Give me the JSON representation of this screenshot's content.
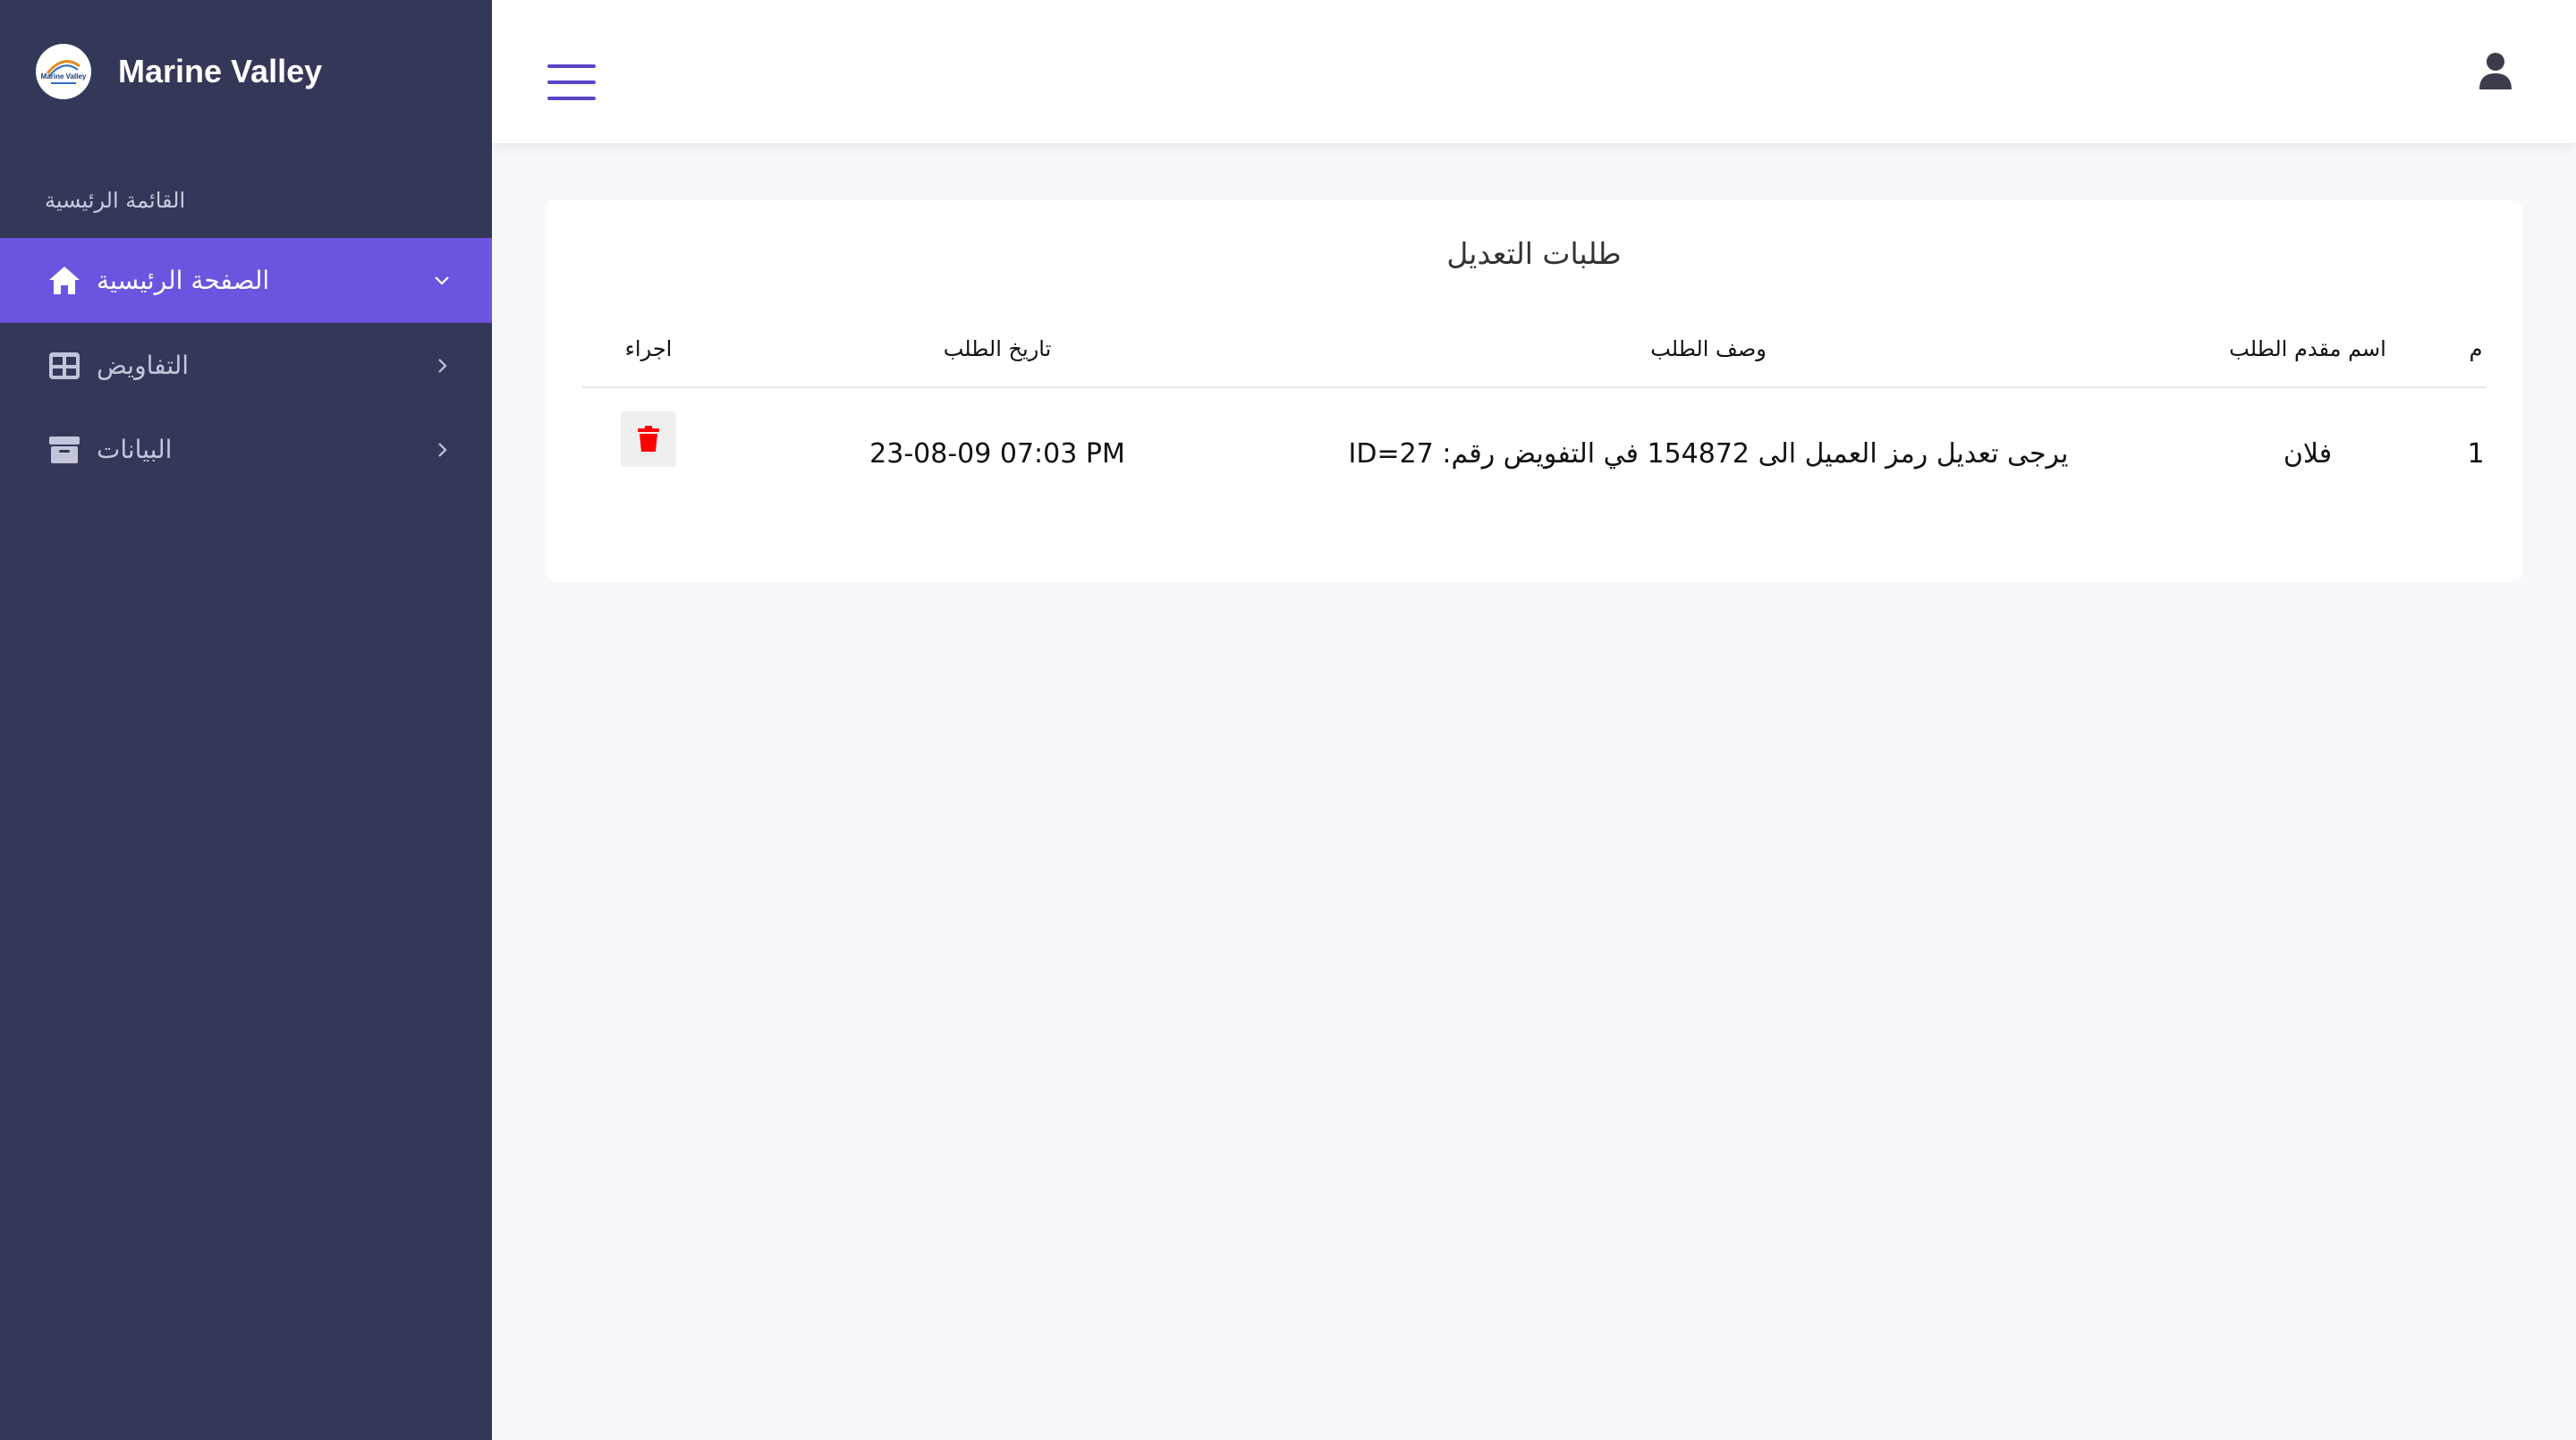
{
  "brand": {
    "name": "Marine Valley",
    "logo_text": "Marine Valley"
  },
  "sidebar": {
    "section_label": "القائمة الرئيسية",
    "items": [
      {
        "label": "الصفحة الرئيسية",
        "icon": "home-icon",
        "active": true,
        "chevron": "chevron-down-icon"
      },
      {
        "label": "التفاويض",
        "icon": "table-icon",
        "active": false,
        "chevron": "chevron-right-icon"
      },
      {
        "label": "البيانات",
        "icon": "archive-icon",
        "active": false,
        "chevron": "chevron-right-icon"
      }
    ]
  },
  "header": {
    "menu_icon": "hamburger-icon",
    "user_icon": "user-icon"
  },
  "card": {
    "title": "طلبات التعديل",
    "columns": [
      "م",
      "اسم مقدم الطلب",
      "وصف الطلب",
      "تاريخ الطلب",
      "اجراء"
    ],
    "rows": [
      {
        "index": "1",
        "applicant": "فلان",
        "description": "يرجى تعديل رمز العميل الى 154872 في التفويض رقم: ID=27",
        "date": "23-08-09 07:03 PM",
        "action_icon": "trash-icon"
      }
    ]
  },
  "colors": {
    "sidebar_bg": "#343858",
    "active_item": "#6c54e0",
    "accent": "#5a44c8",
    "delete": "#ff0000",
    "page_bg": "#f7f8fc"
  }
}
